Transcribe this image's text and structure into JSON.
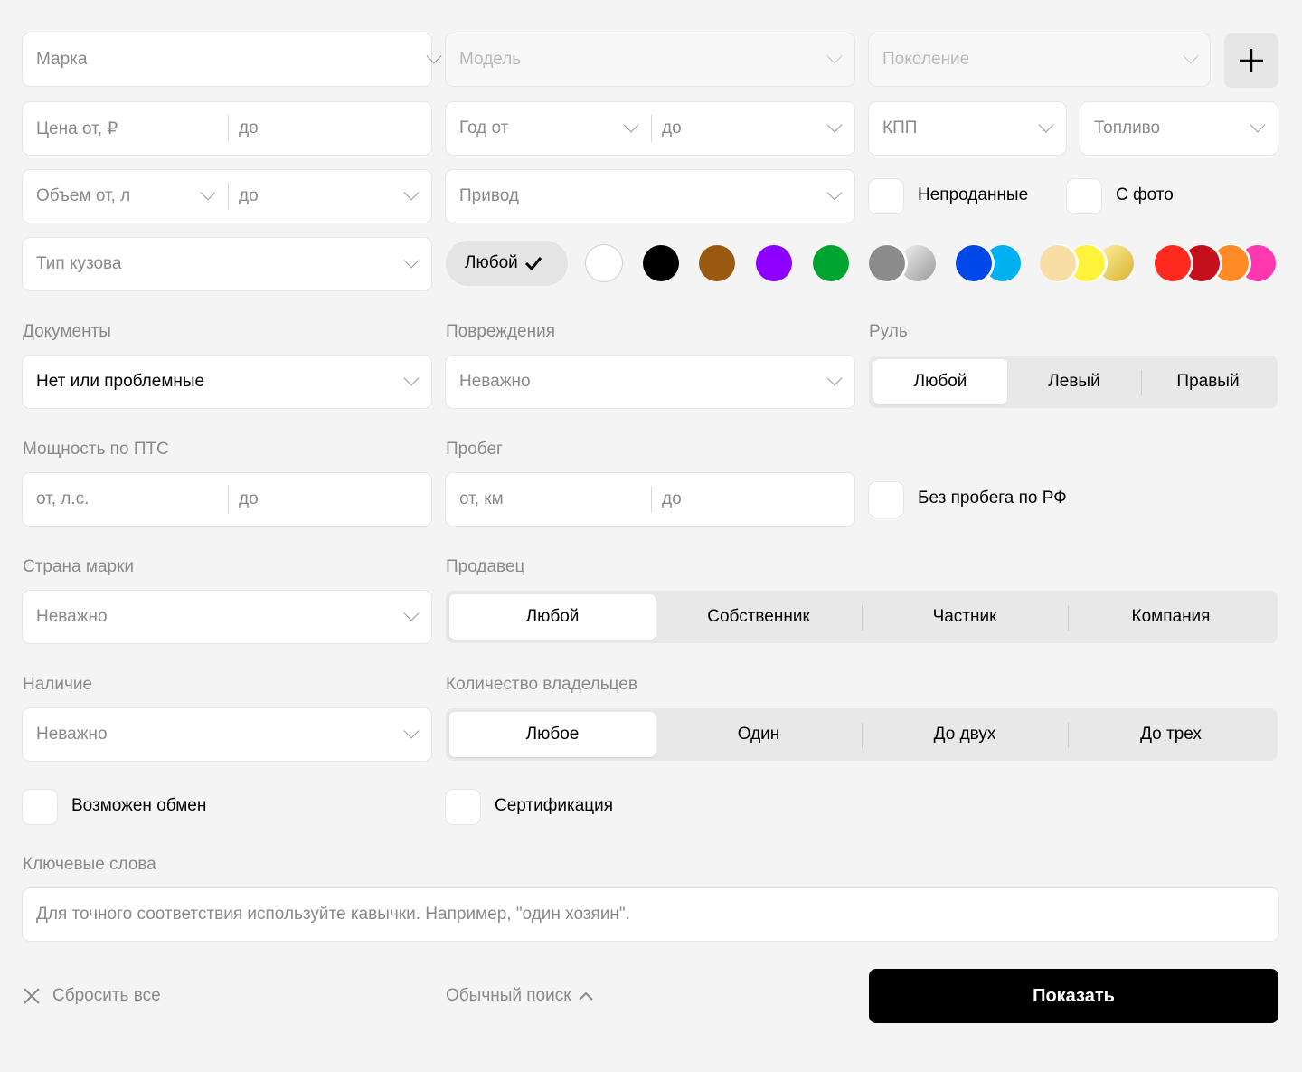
{
  "row1": {
    "brand_placeholder": "Марка",
    "model_placeholder": "Модель",
    "generation_placeholder": "Поколение",
    "add_icon": "plus-icon"
  },
  "row2": {
    "price_from": "Цена от, ₽",
    "price_to": "до",
    "year_from": "Год от",
    "year_to": "до",
    "transmission": "КПП",
    "fuel": "Топливо"
  },
  "row3": {
    "volume_from": "Объем от, л",
    "volume_to": "до",
    "drive": "Привод",
    "unsold_label": "Непроданные",
    "with_photo_label": "С фото"
  },
  "row4": {
    "body_type": "Тип кузова",
    "color_any_label": "Любой",
    "colors": [
      "#ffffff",
      "#000000",
      "#9b5a12",
      "#8b00ff",
      "#00a531",
      "#8c8c8c/#c8c8c8",
      "#0047e8/#00b0f0",
      "#f8dea4/#fff23a/#e5c84a",
      "#ff2a1e/#c3101c/#ff8a26/#ff38b0"
    ]
  },
  "documents": {
    "label": "Документы",
    "value": "Нет или проблемные"
  },
  "damage": {
    "label": "Повреждения",
    "placeholder": "Неважно"
  },
  "wheel": {
    "label": "Руль",
    "options": [
      "Любой",
      "Левый",
      "Правый"
    ],
    "selected": "Любой"
  },
  "power": {
    "label": "Мощность по ПТС",
    "from": "от, л.с.",
    "to": "до"
  },
  "mileage": {
    "label": "Пробег",
    "from": "от, км",
    "to": "до"
  },
  "no_ru_mileage": {
    "label": "Без пробега по РФ"
  },
  "country": {
    "label": "Страна марки",
    "placeholder": "Неважно"
  },
  "seller": {
    "label": "Продавец",
    "options": [
      "Любой",
      "Собственник",
      "Частник",
      "Компания"
    ],
    "selected": "Любой"
  },
  "availability": {
    "label": "Наличие",
    "placeholder": "Неважно"
  },
  "owners": {
    "label": "Количество владельцев",
    "options": [
      "Любое",
      "Один",
      "До двух",
      "До трех"
    ],
    "selected": "Любое"
  },
  "exchange": {
    "label": "Возможен обмен"
  },
  "certification": {
    "label": "Сертификация"
  },
  "keywords": {
    "label": "Ключевые слова",
    "placeholder": "Для точного соответствия используйте кавычки. Например, \"один хозяин\"."
  },
  "footer": {
    "reset_label": "Сбросить все",
    "simple_search_label": "Обычный поиск",
    "show_label": "Показать"
  }
}
